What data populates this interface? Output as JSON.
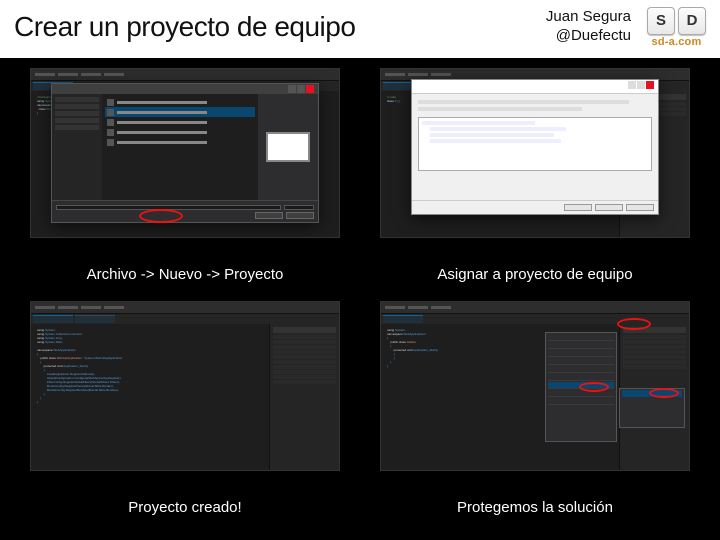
{
  "header": {
    "title": "Crear un proyecto de equipo",
    "author_name": "Juan Segura",
    "author_handle": "@Duefectu",
    "logo_key_s": "S",
    "logo_key_d": "D",
    "logo_text": "sd-a.com"
  },
  "captions": {
    "c1": "Archivo -> Nuevo -> Proyecto",
    "c2": "Asignar a proyecto de equipo",
    "c3": "Proyecto creado!",
    "c4": "Protegemos la solución"
  }
}
